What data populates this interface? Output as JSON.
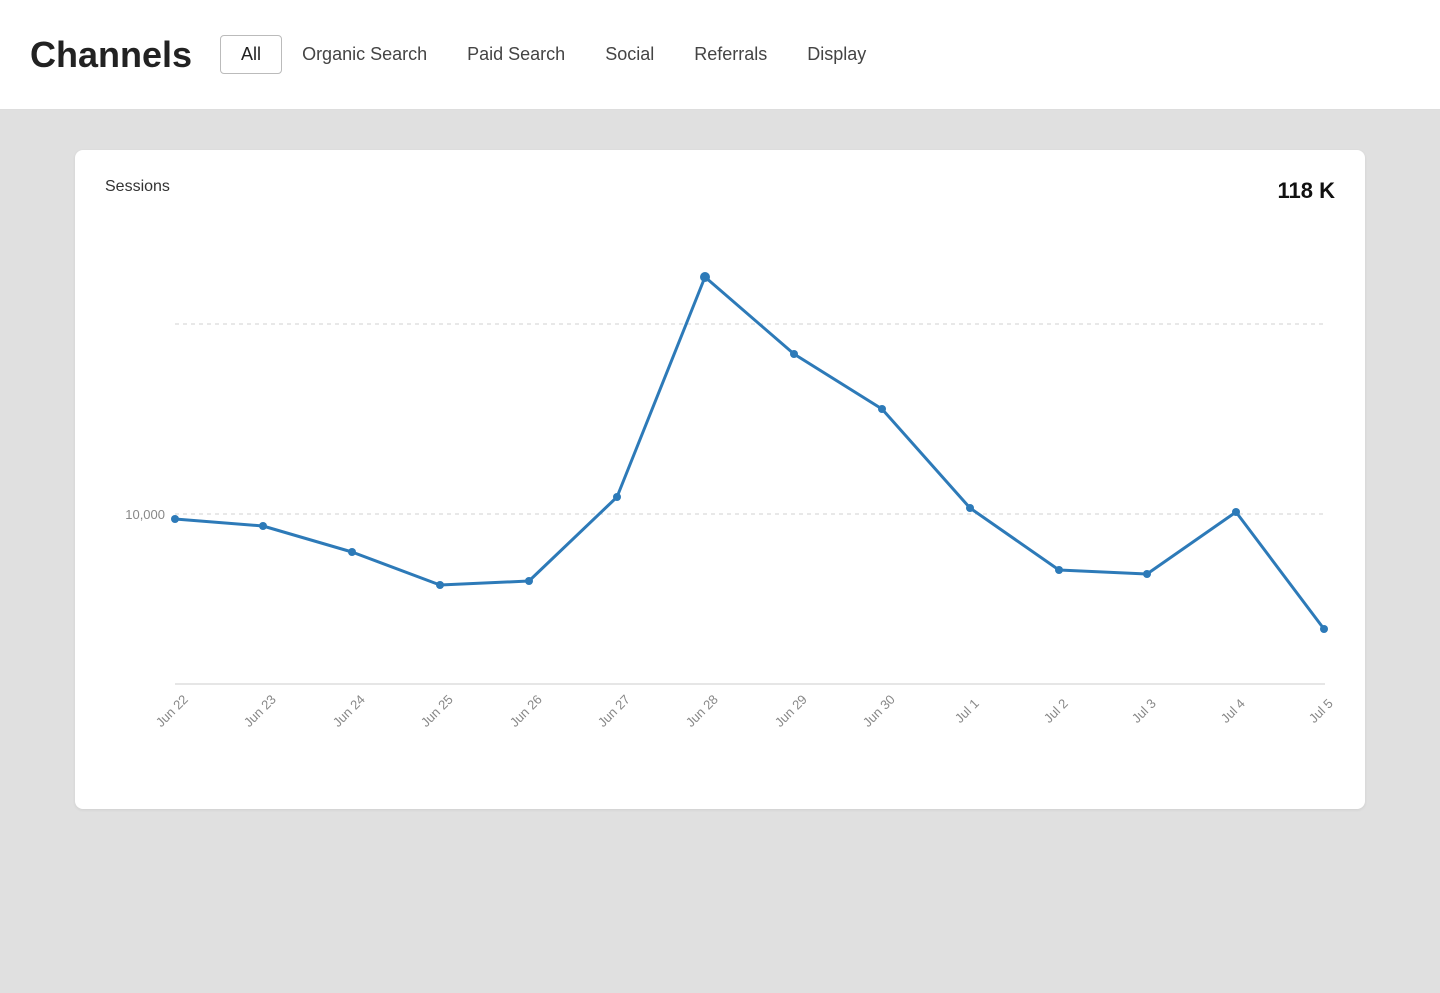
{
  "header": {
    "title": "Channels",
    "tabs": [
      {
        "label": "All",
        "active": true
      },
      {
        "label": "Organic Search",
        "active": false
      },
      {
        "label": "Paid Search",
        "active": false
      },
      {
        "label": "Social",
        "active": false
      },
      {
        "label": "Referrals",
        "active": false
      },
      {
        "label": "Display",
        "active": false
      }
    ]
  },
  "chart": {
    "label": "Sessions",
    "value": "118 K",
    "y_axis_label": "10,000",
    "x_labels": [
      "Jun 22",
      "Jun 23",
      "Jun 24",
      "Jun 25",
      "Jun 26",
      "Jun 27",
      "Jun 28",
      "Jun 29",
      "Jun 30",
      "Jul 1",
      "Jul 2",
      "Jul 3",
      "Jul 4",
      "Jul 5"
    ],
    "line_color": "#2d7ab8",
    "grid_color": "#d8d8d8"
  }
}
